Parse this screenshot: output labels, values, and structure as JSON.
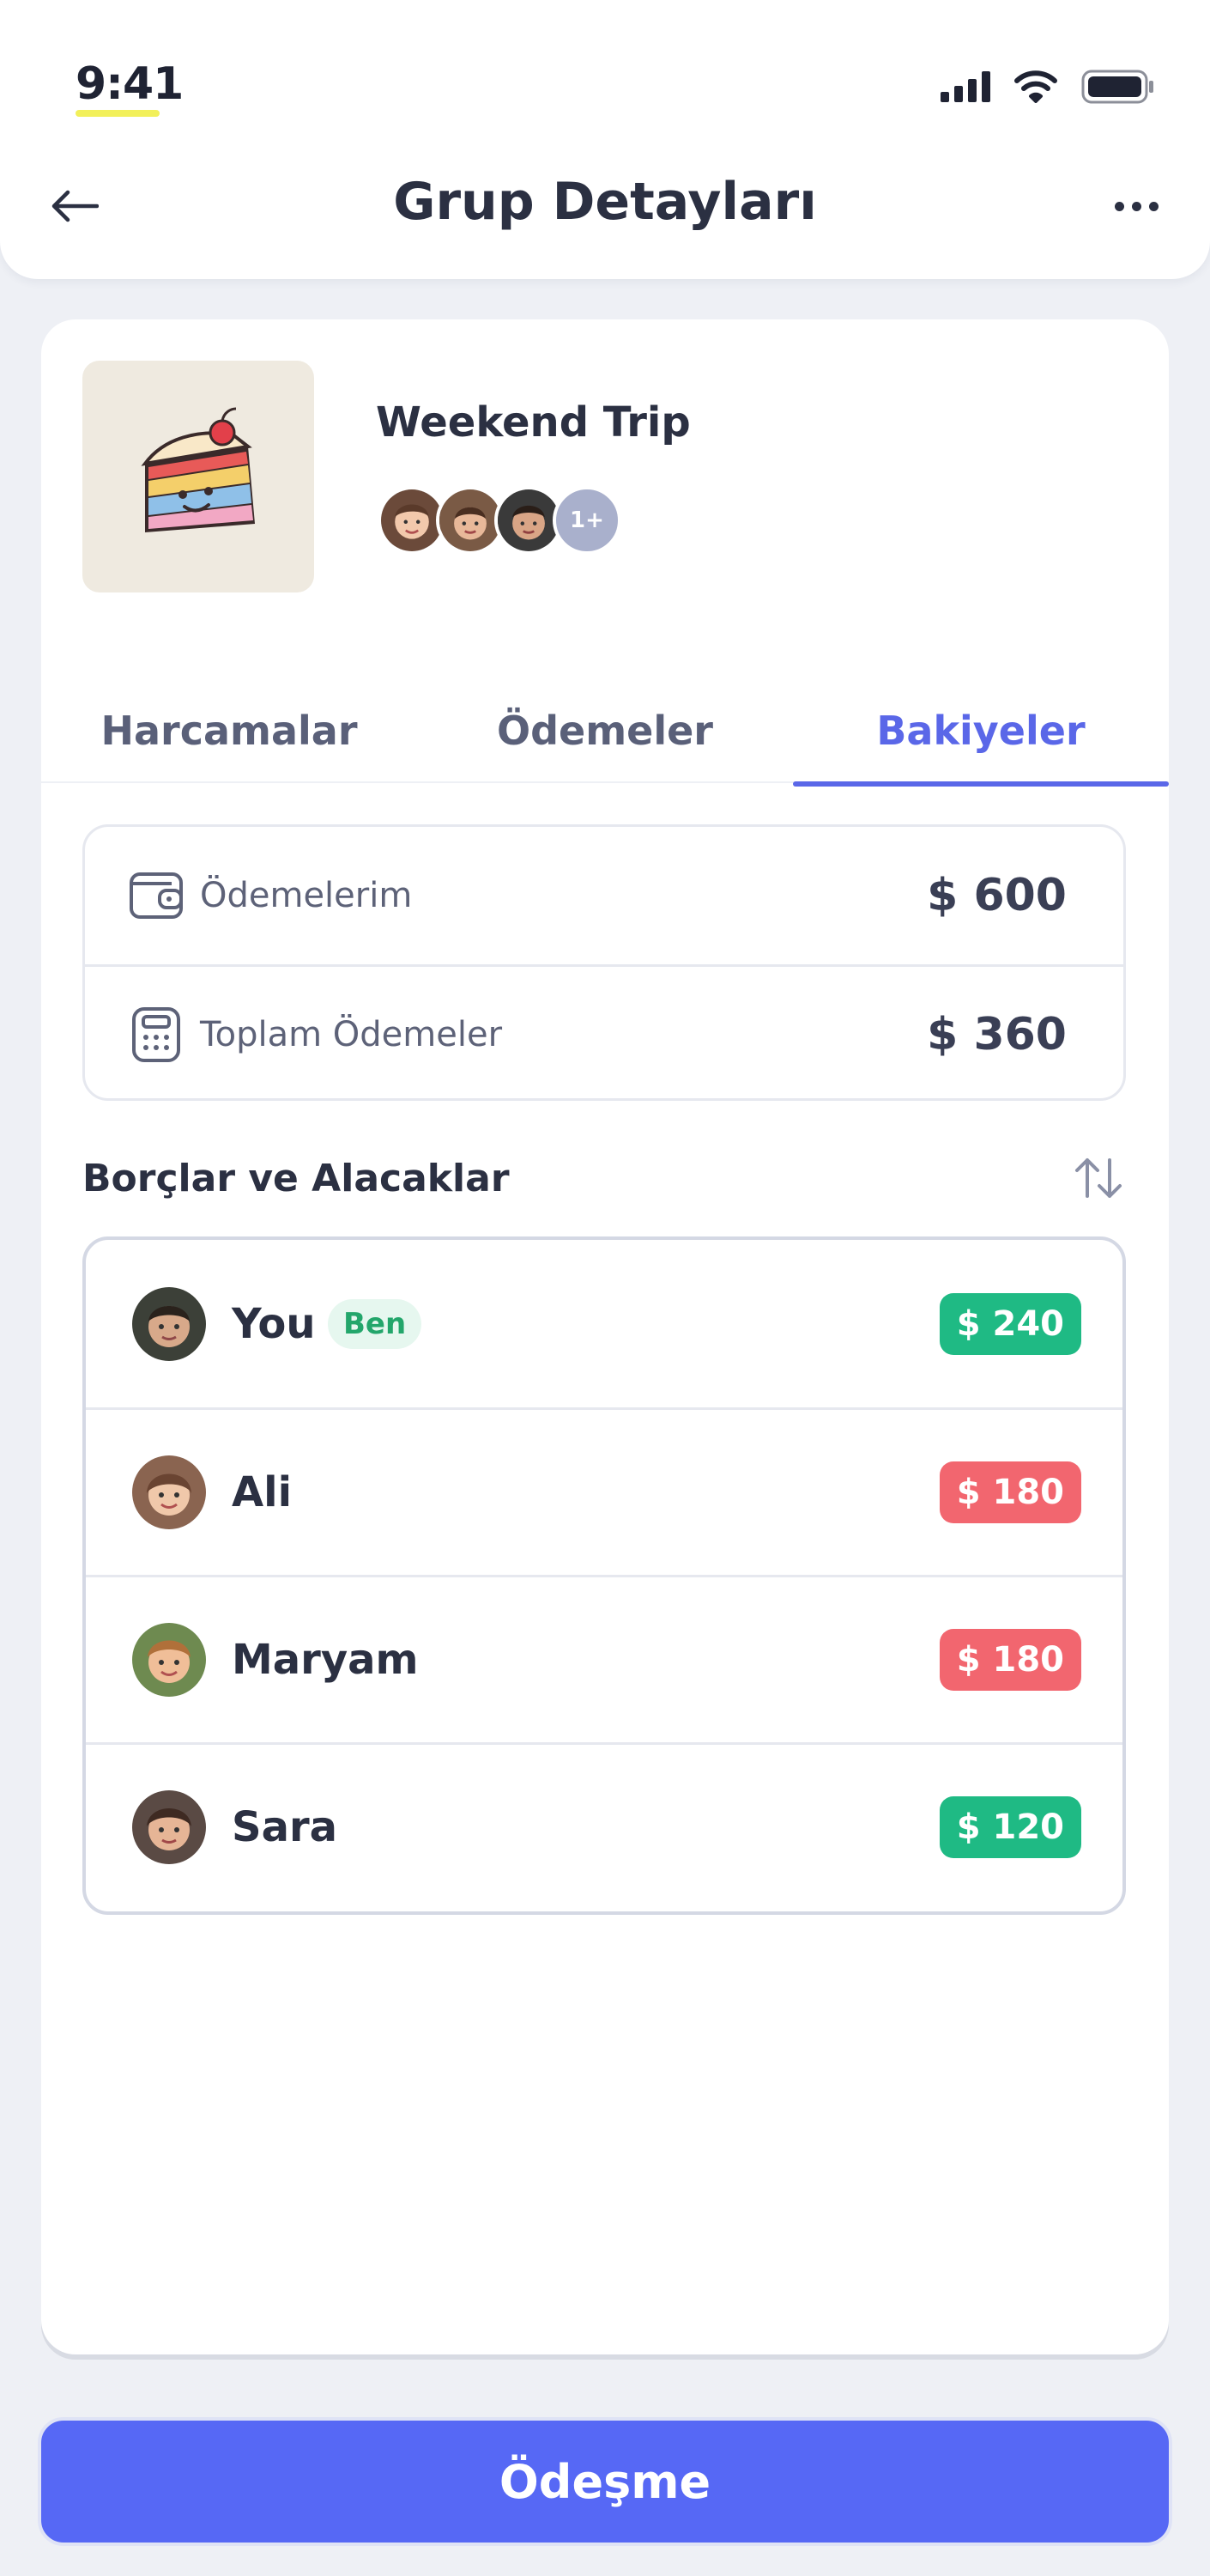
{
  "status_bar": {
    "time": "9:41"
  },
  "header": {
    "title": "Grup Detayları"
  },
  "group": {
    "name": "Weekend Trip",
    "members_more": "1+"
  },
  "tabs": [
    {
      "label": "Harcamalar",
      "active": false
    },
    {
      "label": "Ödemeler",
      "active": false
    },
    {
      "label": "Bakiyeler",
      "active": true
    }
  ],
  "summary": {
    "my_payments": {
      "label": "Ödemelerim",
      "value": "$ 600",
      "icon": "wallet-icon"
    },
    "total_payments": {
      "label": "Toplam Ödemeler",
      "value": "$ 360",
      "icon": "calculator-icon"
    }
  },
  "section": {
    "title": "Borçlar ve Alacaklar"
  },
  "people": [
    {
      "name": "You",
      "badge": "Ben",
      "amount": "$ 240",
      "status": "positive"
    },
    {
      "name": "Ali",
      "amount": "$ 180",
      "status": "negative"
    },
    {
      "name": "Maryam",
      "amount": "$ 180",
      "status": "negative"
    },
    {
      "name": "Sara",
      "amount": "$ 120",
      "status": "positive"
    }
  ],
  "footer": {
    "button_label": "Ödeşme"
  },
  "colors": {
    "accent": "#5a67e8",
    "button": "#5668f5",
    "positive": "#1fba84",
    "negative": "#f2666f"
  }
}
